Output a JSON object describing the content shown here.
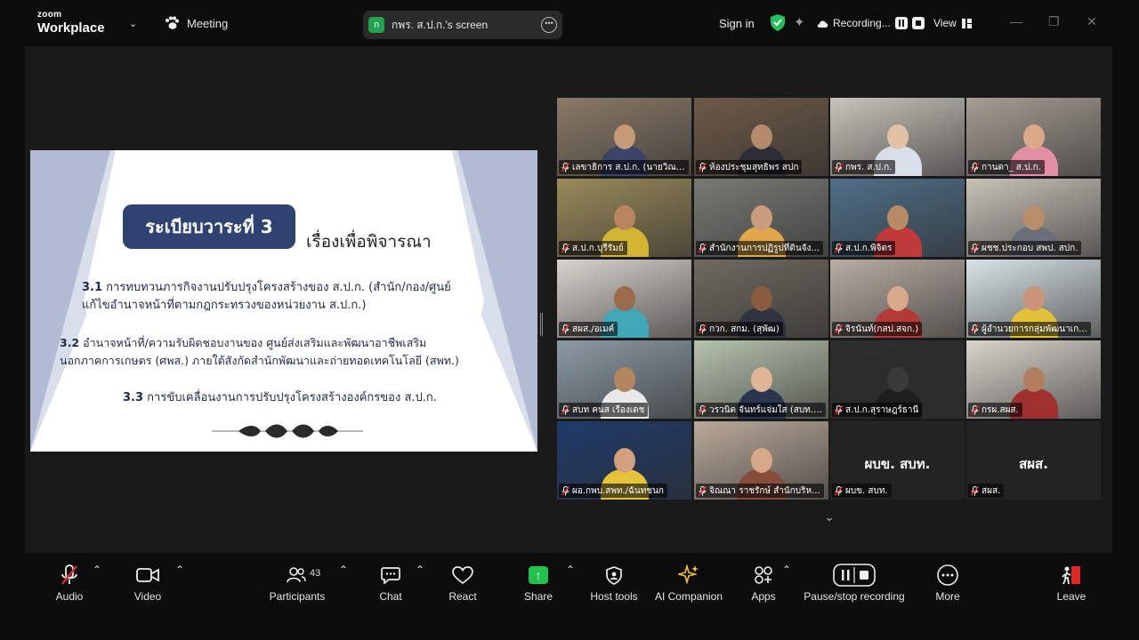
{
  "app": {
    "brand_line1": "zoom",
    "brand_line2": "Workplace",
    "meeting_label": "Meeting"
  },
  "share_pill": {
    "avatar_letter": "ก",
    "label": "กพร. ส.ป.ก.'s screen"
  },
  "header": {
    "sign_in": "Sign in",
    "recording": "Recording...",
    "view": "View"
  },
  "slide": {
    "agenda_title": "ระเบียบวาระที่ 3",
    "agenda_subtitle": "เรื่องเพื่อพิจารณา",
    "item1_num": "3.1",
    "item1_line1": " การทบทวนภารกิจงานปรับปรุงโครงสร้างของ ส.ป.ก. (สำนัก/กอง/ศูนย์",
    "item1_line2": "แก้ไขอำนาจหน้าที่ตามกฎกระทรวงของหน่วยงาน ส.ป.ก.)",
    "item2_num": "3.2",
    "item2_line1": " อำนาจหน้าที่/ความรับผิดชอบงานของ ศูนย์ส่งเสริมและพัฒนาอาชีพเสริม",
    "item2_line2": "นอกภาคการเกษตร (ศพส.) ภายใต้สังกัดสำนักพัฒนาและถ่ายทอดเทคโนโลยี (สพท.)",
    "item3_num": "3.3",
    "item3_line1": " การขับเคลื่อนงานการปรับปรุงโครงสร้างองค์กรของ ส.ป.ก."
  },
  "participants": [
    {
      "name": "เลขาธิการ ส.ป.ก. (นายวิณะโร...",
      "bg": "#8a7a68",
      "skin": "#c49a77",
      "shirt": "#3a4466",
      "active": true
    },
    {
      "name": "ห้องประชุมสุทธิพร สปก",
      "bg": "#6d5a48",
      "skin": "#b58a6a",
      "shirt": "#2e2e36",
      "active": false
    },
    {
      "name": "กพร. ส.ป.ก.",
      "bg": "#c9c4bb",
      "skin": "#e2c2a6",
      "shirt": "#d9dfe8",
      "active": false
    },
    {
      "name": "กานดา_ ส.ป.ก.",
      "bg": "#a79e94",
      "skin": "#d9a98a",
      "shirt": "#e28fa3",
      "active": false
    },
    {
      "name": "ส.ป.ก.บุรีรัมย์",
      "bg": "#9a8a5a",
      "skin": "#b8855f",
      "shirt": "#d4b433",
      "active": false
    },
    {
      "name": "สำนักงานการปฏิรูปที่ดินจัง...",
      "bg": "#7a7a74",
      "skin": "#c89c7c",
      "shirt": "#e2a74a",
      "active": false
    },
    {
      "name": "ส.ป.ก.พิจิตร",
      "bg": "#4f6f88",
      "skin": "#b88a66",
      "shirt": "#c03a3a",
      "active": false
    },
    {
      "name": "ผชช.ประกอบ สพป. สปก.",
      "bg": "#c8c2b8",
      "skin": "#b98c6a",
      "shirt": "#6a6e78",
      "active": false
    },
    {
      "name": "สผส./อเมค์",
      "bg": "#d8d3cc",
      "skin": "#9a6a4a",
      "shirt": "#3fa7b6",
      "active": false
    },
    {
      "name": "กวก. สกม. (สุพัฒ)",
      "bg": "#6f6a60",
      "skin": "#8a5c3e",
      "shirt": "#2f3440",
      "active": false
    },
    {
      "name": "จิรนันท์(กสป.สจก.)",
      "bg": "#b9ada3",
      "skin": "#d8a98a",
      "shirt": "#b33a36",
      "active": false
    },
    {
      "name": "ผู้อำนวยการกลุ่มพัฒนาเก...",
      "bg": "#d9e4e6",
      "skin": "#c99478",
      "shirt": "#e3c23a",
      "active": false
    },
    {
      "name": "สบท คนส เรืองเดช",
      "bg": "#8d9aa5",
      "skin": "#b48660",
      "shirt": "#e8e8e8",
      "active": false
    },
    {
      "name": "วรวนิต จันทร์แจ่มใส (สบท. ...",
      "bg": "#b6c2ad",
      "skin": "#e0b497",
      "shirt": "#2a3550",
      "active": false
    },
    {
      "name": "ส.ป.ก.สุราษฎร์ธานี",
      "bg": "#2d2d2d",
      "skin": "#3a3a3a",
      "shirt": "#1e1e1e",
      "active": false
    },
    {
      "name": "กรผ.สผส.",
      "bg": "#d9d4cc",
      "skin": "#b07e5e",
      "shirt": "#a03030",
      "active": false
    },
    {
      "name": "ผอ.กพบ.สพท./ฉันทชนก",
      "bg": "#1f3b6a",
      "skin": "#d2a07c",
      "shirt": "#e5c23a",
      "active": false
    },
    {
      "name": "จิณณา ราชรักษ์ สำนักบริห...",
      "bg": "#b9a99a",
      "skin": "#d7a88a",
      "shirt": "#8a4c3a",
      "active": false
    },
    {
      "name": "ผบข. สบท.",
      "bg": "#232323",
      "big": "ผบข. สบท.",
      "active": false
    },
    {
      "name": "สผส.",
      "bg": "#232323",
      "big": "สผส.",
      "active": false
    }
  ],
  "toolbar": {
    "audio": "Audio",
    "video": "Video",
    "participants": "Participants",
    "participants_count": "43",
    "chat": "Chat",
    "react": "React",
    "share": "Share",
    "host_tools": "Host tools",
    "ai_companion": "AI Companion",
    "apps": "Apps",
    "pause_stop": "Pause/stop recording",
    "more": "More",
    "leave": "Leave"
  },
  "colors": {
    "active_speaker": "#23d160",
    "share_accent": "#21c14e",
    "leave_red": "#e02828",
    "slide_navy": "#2f4372"
  }
}
